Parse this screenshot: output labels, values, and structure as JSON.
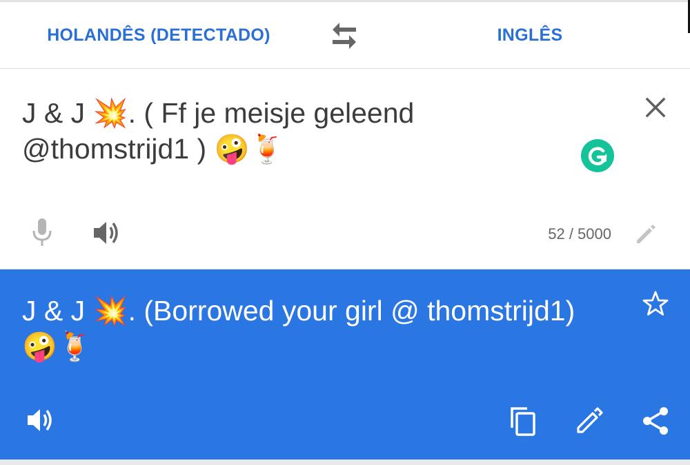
{
  "language_bar": {
    "source_language": "HOLANDÊS (DETECTADO)",
    "target_language": "INGLÊS",
    "swap_icon": "swap-arrows-icon"
  },
  "source": {
    "text": "J & J 💥. ( Ff je meisje geleend @thomstrijd1 ) 🤪🍹",
    "char_count": "52 / 5000",
    "icons": [
      "close-icon",
      "grammarly-icon",
      "microphone-icon",
      "speaker-icon",
      "pencil-icon"
    ]
  },
  "translation": {
    "text": "J & J 💥. (Borrowed your girl @ thomstrijd1) 🤪🍹",
    "icons": [
      "star-icon",
      "speaker-icon",
      "copy-icon",
      "pencil-icon",
      "share-icon"
    ]
  },
  "colors": {
    "accent": "#2a6fd6",
    "translation_bg": "#2a76e2",
    "grammarly_green": "#15c39a",
    "text_dark": "#3c3c3c",
    "icon_gray": "#666666"
  }
}
